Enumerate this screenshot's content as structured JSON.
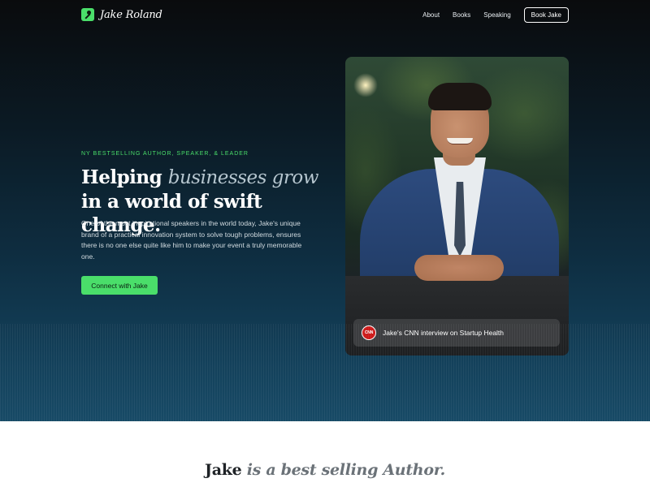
{
  "nav": {
    "brand": "Jake Roland",
    "links": [
      "About",
      "Books",
      "Speaking"
    ],
    "book_button": "Book Jake"
  },
  "hero": {
    "eyebrow": "NY BESTSELLING AUTHOR, SPEAKER, & LEADER",
    "headline_pre": "Helping ",
    "headline_emphasis": "businesses grow",
    "headline_post": " in a world of swift change.",
    "body": "One of the most inspirational speakers in the world today, Jake's unique brand of a practical innovation system to solve tough problems, ensures there is no one else quite like him to make your event a truly memorable one.",
    "cta": "Connect with Jake"
  },
  "photo": {
    "caption": "Jake's CNN interview on Startup Health",
    "caption_logo": "CNN",
    "slides_total": 2,
    "slide_active": 2
  },
  "intro": {
    "name": "Jake",
    "connector": " is a ",
    "role": "best selling Author."
  },
  "colors": {
    "accent": "#4ade6a",
    "hero_top": "#0a0b0d",
    "hero_bottom": "#174a66",
    "cnn_red": "#cc1a1a"
  },
  "icons": {
    "brand": "pen-nib-icon",
    "caption": "cnn-logo-icon"
  }
}
